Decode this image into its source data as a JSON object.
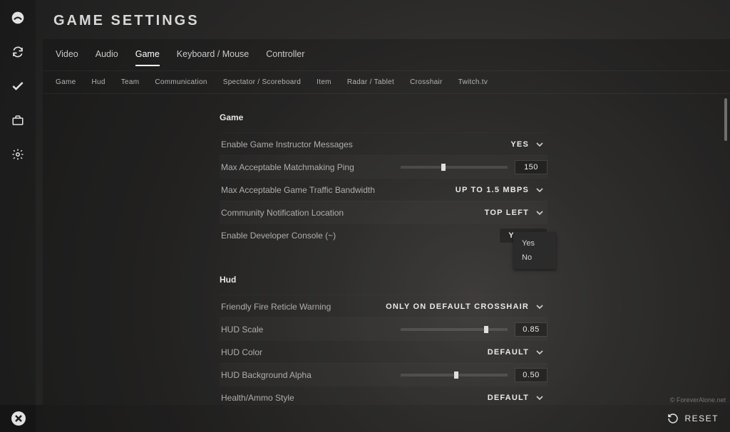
{
  "title": "GAME SETTINGS",
  "primary_tabs": [
    "Video",
    "Audio",
    "Game",
    "Keyboard / Mouse",
    "Controller"
  ],
  "primary_tab_active": 2,
  "secondary_tabs": [
    "Game",
    "Hud",
    "Team",
    "Communication",
    "Spectator / Scoreboard",
    "Item",
    "Radar / Tablet",
    "Crosshair",
    "Twitch.tv"
  ],
  "sections": {
    "game": {
      "heading": "Game",
      "rows": {
        "instructor": {
          "label": "Enable Game Instructor Messages",
          "value": "YES"
        },
        "ping": {
          "label": "Max Acceptable Matchmaking Ping",
          "value": "150",
          "slider_pct": 38
        },
        "bandwidth": {
          "label": "Max Acceptable Game Traffic Bandwidth",
          "value": "UP TO 1.5 MBPS"
        },
        "notification": {
          "label": "Community Notification Location",
          "value": "TOP LEFT"
        },
        "devconsole": {
          "label": "Enable Developer Console (~)",
          "value": "YES",
          "options": [
            "Yes",
            "No"
          ]
        }
      }
    },
    "hud": {
      "heading": "Hud",
      "rows": {
        "ffwarn": {
          "label": "Friendly Fire Reticle Warning",
          "value": "ONLY ON DEFAULT CROSSHAIR"
        },
        "scale": {
          "label": "HUD Scale",
          "value": "0.85",
          "slider_pct": 78
        },
        "color": {
          "label": "HUD Color",
          "value": "DEFAULT"
        },
        "bgalpha": {
          "label": "HUD Background Alpha",
          "value": "0.50",
          "slider_pct": 50
        },
        "hpammo": {
          "label": "Health/Ammo Style",
          "value": "DEFAULT"
        }
      }
    }
  },
  "footer": {
    "reset": "RESET"
  },
  "watermark": "© ForeverAlone.net"
}
